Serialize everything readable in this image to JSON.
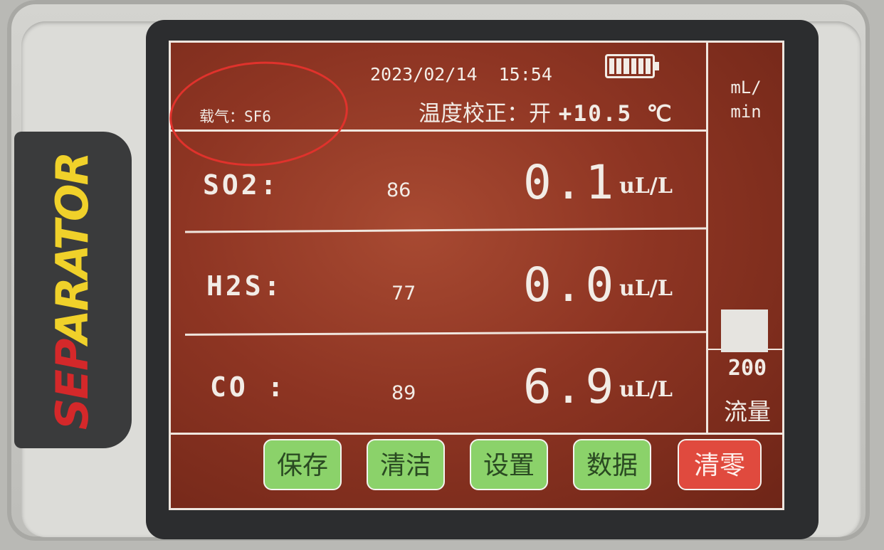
{
  "brand": {
    "part1": "SEP",
    "part2": "ARATOR"
  },
  "header": {
    "date": "2023/02/14",
    "time": "15:54",
    "carrier_gas": "载气：SF6",
    "temp_correction_label": "温度校正：开",
    "temp_correction_value": "+10.5 ℃",
    "battery_level": 1.0
  },
  "flow": {
    "unit": "mL/\nmin",
    "value": "200",
    "label": "流量",
    "level_fraction": 0.2
  },
  "gases": [
    {
      "name": "SO2:",
      "raw": "86",
      "value": "0.1",
      "unit": "uL/L"
    },
    {
      "name": "H2S:",
      "raw": "77",
      "value": "0.0",
      "unit": "uL/L"
    },
    {
      "name": "CO  :",
      "raw": "89",
      "value": "6.9",
      "unit": "uL/L"
    }
  ],
  "buttons": {
    "save": "保存",
    "clean": "清洁",
    "settings": "设置",
    "data": "数据",
    "zero": "清零"
  },
  "colors": {
    "screen_bg": "#8e3523",
    "button_green": "#8bd26a",
    "button_red": "#e04a3e",
    "annotation_red": "#e0322c",
    "brand_red": "#d4282a",
    "brand_yellow": "#f0d12a"
  }
}
